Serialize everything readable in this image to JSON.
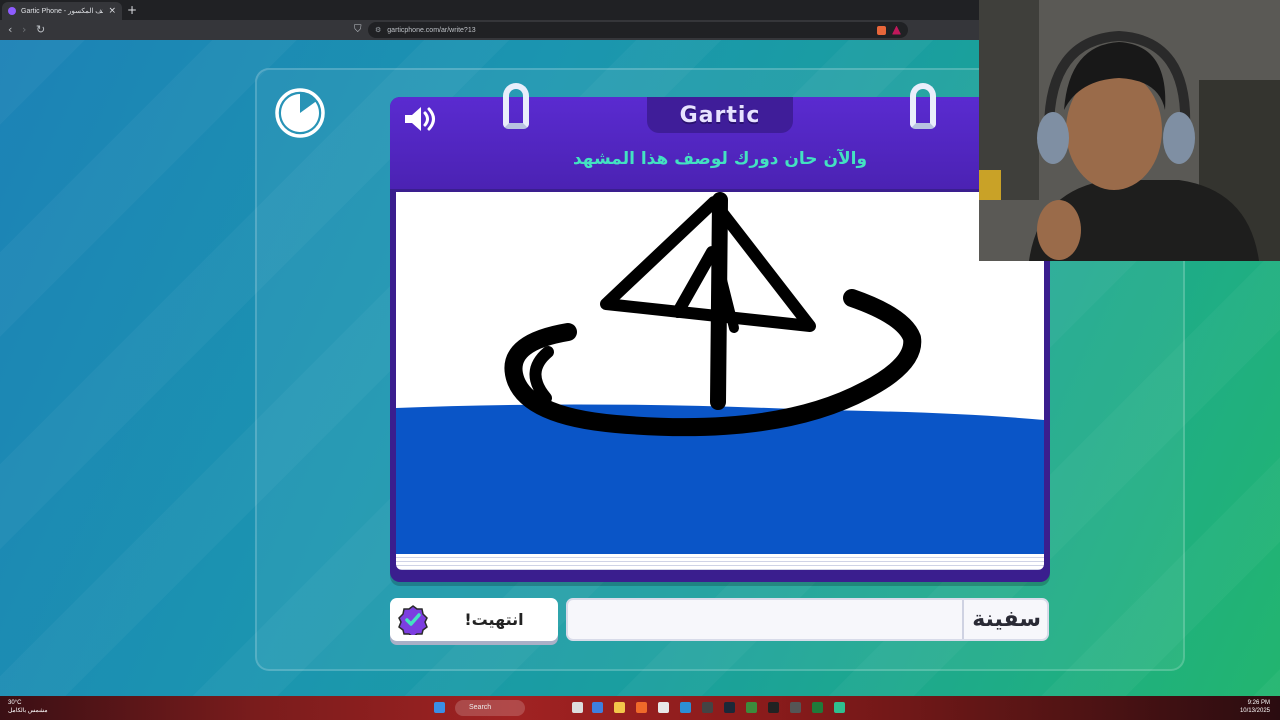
{
  "browser": {
    "tab_title": "Gartic Phone - لعبة الهاتف المكسور",
    "new_tab": "+",
    "tab_close": "×",
    "url": "garticphone.com/ar/write?13",
    "back": "‹",
    "forward": "›",
    "reload": "↻"
  },
  "game": {
    "logo": "Gartic",
    "prompt": "والآن حان دورك لوصف هذا المشهد",
    "answer_value": "سفينة",
    "done_label": "انتهيت!",
    "timer_remaining": 0.85,
    "accent_color": "#43e2c1",
    "panel_color": "#4b22b3"
  },
  "taskbar": {
    "temp": "30°C",
    "weather": "مشمس بالكامل",
    "search": "Search",
    "time": "9:26 PM",
    "date": "10/13/2025"
  }
}
